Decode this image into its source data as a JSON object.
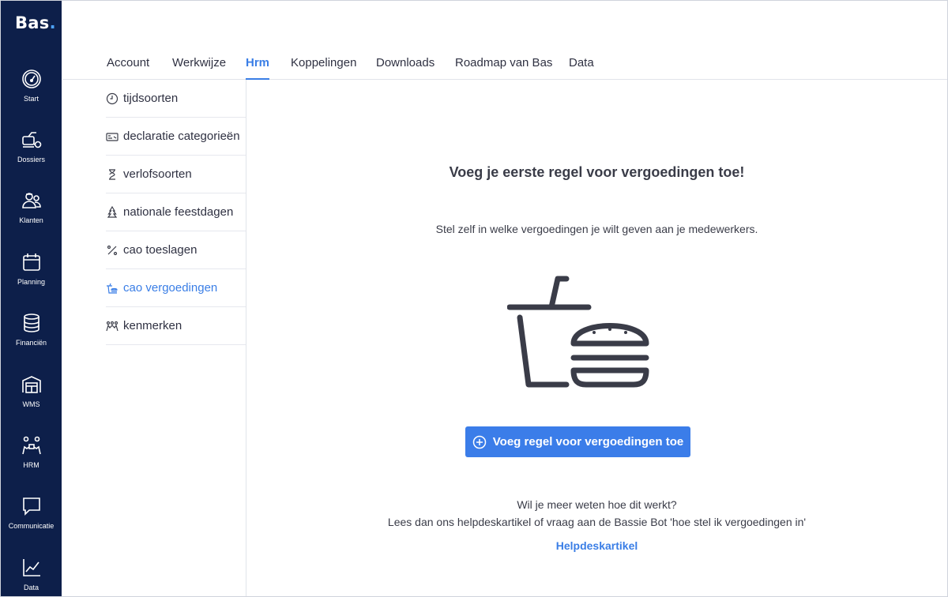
{
  "app": {
    "logo_text": "Bas",
    "logo_dot": "."
  },
  "sidebar": {
    "items": [
      {
        "label": "Start",
        "icon": "gauge-icon"
      },
      {
        "label": "Dossiers",
        "icon": "dossier-icon"
      },
      {
        "label": "Klanten",
        "icon": "customers-icon"
      },
      {
        "label": "Planning",
        "icon": "calendar-icon"
      },
      {
        "label": "Financiën",
        "icon": "coins-icon"
      },
      {
        "label": "WMS",
        "icon": "warehouse-icon"
      },
      {
        "label": "HRM",
        "icon": "people-icon"
      },
      {
        "label": "Communicatie",
        "icon": "chat-icon"
      },
      {
        "label": "Data",
        "icon": "line-chart-icon"
      }
    ]
  },
  "tabs": [
    {
      "label": "Account"
    },
    {
      "label": "Werkwijze"
    },
    {
      "label": "Hrm",
      "active": true
    },
    {
      "label": "Koppelingen"
    },
    {
      "label": "Downloads"
    },
    {
      "label": "Roadmap van Bas"
    },
    {
      "label": "Data"
    }
  ],
  "subnav": [
    {
      "label": "tijdsoorten",
      "icon": "clock-icon"
    },
    {
      "label": "declaratie categorieën",
      "icon": "receipt-icon"
    },
    {
      "label": "verlofsoorten",
      "icon": "hourglass-icon"
    },
    {
      "label": "nationale feestdagen",
      "icon": "tree-icon"
    },
    {
      "label": "cao toeslagen",
      "icon": "percent-icon"
    },
    {
      "label": "cao vergoedingen",
      "icon": "food-icon",
      "active": true
    },
    {
      "label": "kenmerken",
      "icon": "group-icon"
    }
  ],
  "main": {
    "title": "Voeg je eerste regel voor vergoedingen toe!",
    "subtitle": "Stel zelf in welke vergoedingen je wilt geven aan je medewerkers.",
    "illustration_icon": "drink-burger-icon",
    "cta_label": "Voeg regel voor vergoedingen toe",
    "help_question": "Wil je meer weten hoe dit werkt?",
    "help_text": "Lees dan ons helpdeskartikel of vraag aan de Bassie Bot 'hoe stel ik vergoedingen in'",
    "help_link": "Helpdeskartikel"
  },
  "colors": {
    "sidebar_bg": "#0d1f4a",
    "accent": "#3a7ee6",
    "button_bg": "#3b7de9",
    "illustration": "#3a3c48"
  }
}
